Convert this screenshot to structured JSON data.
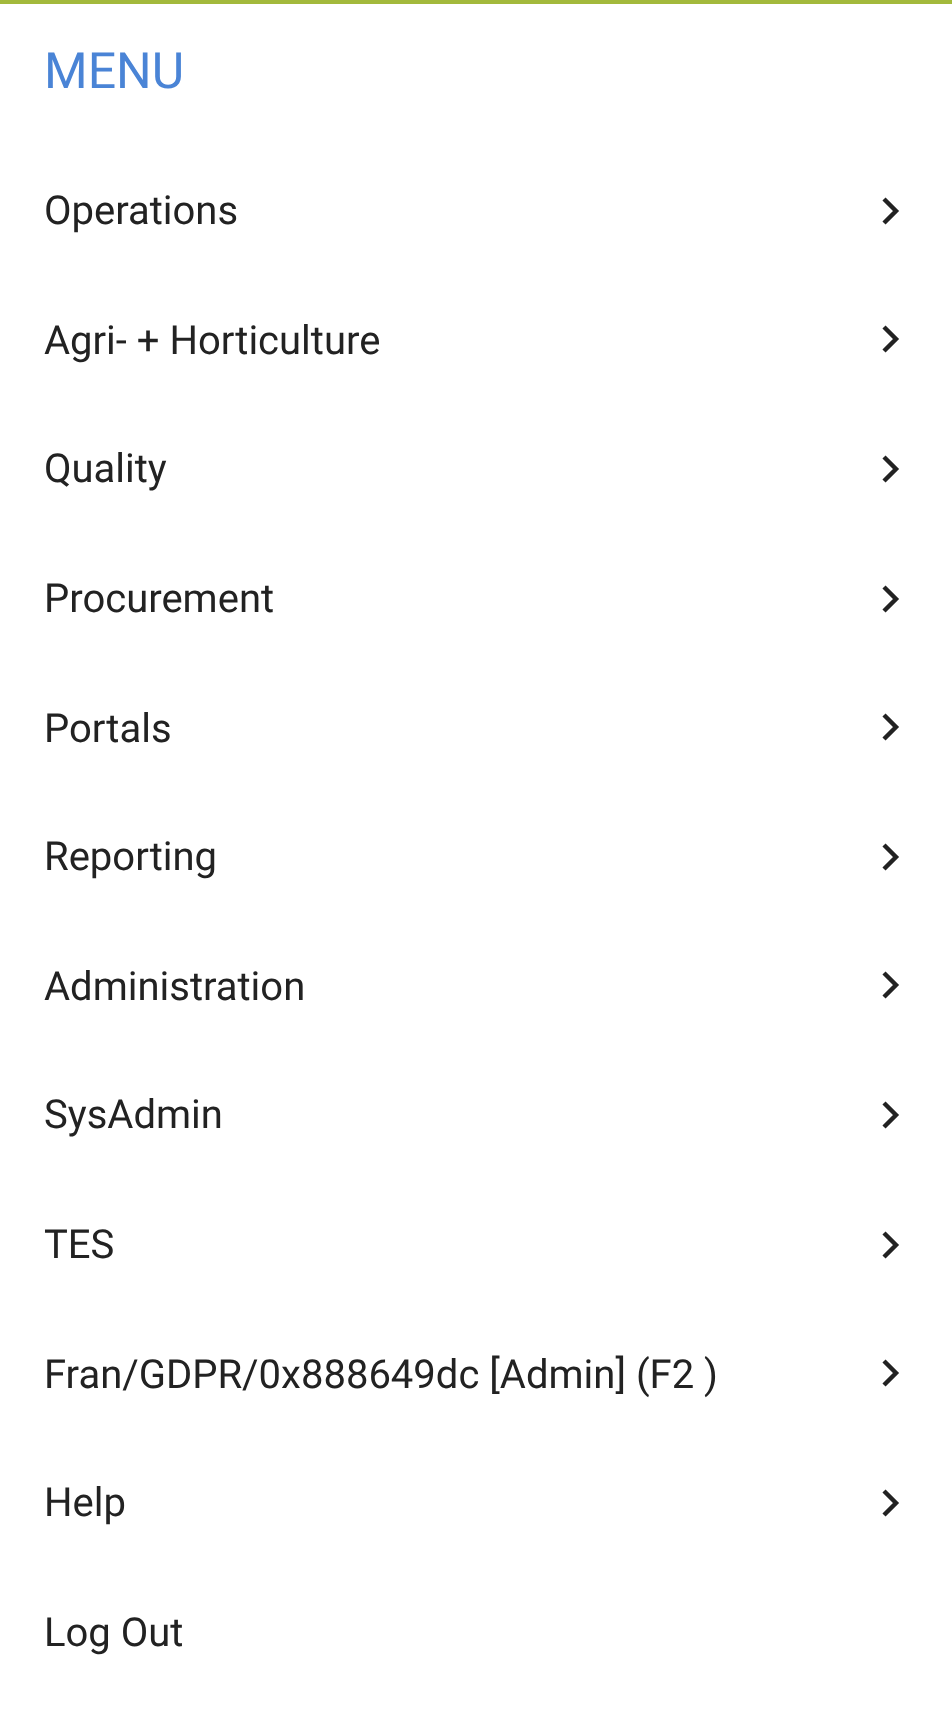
{
  "title": "MENU",
  "items": [
    {
      "label": "Operations",
      "kind": "submenu"
    },
    {
      "label": "Agri- + Horticulture",
      "kind": "submenu"
    },
    {
      "label": "Quality",
      "kind": "submenu"
    },
    {
      "label": "Procurement",
      "kind": "submenu"
    },
    {
      "label": "Portals",
      "kind": "submenu"
    },
    {
      "label": "Reporting",
      "kind": "submenu"
    },
    {
      "label": "Administration",
      "kind": "submenu"
    },
    {
      "label": "SysAdmin",
      "kind": "submenu"
    },
    {
      "label": "TES",
      "kind": "submenu"
    },
    {
      "label": "Fran/GDPR/0x888649dc [Admin] (F2 )",
      "kind": "submenu"
    },
    {
      "label": "Help",
      "kind": "submenu"
    },
    {
      "label": "Log Out",
      "kind": "action"
    }
  ]
}
